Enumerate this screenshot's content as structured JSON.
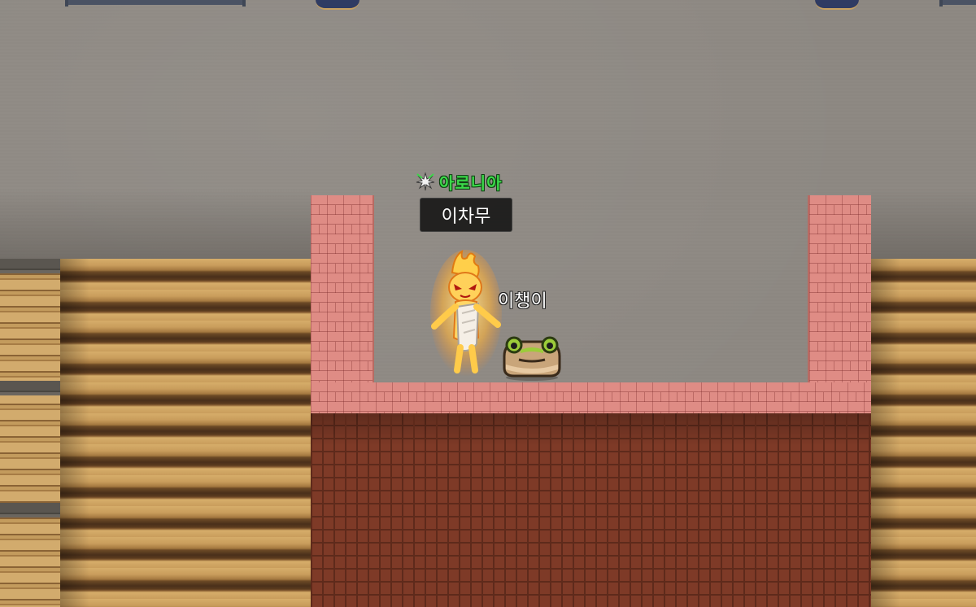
{
  "player": {
    "guild_name": "아로니아",
    "guild_icon": "leaf-emblem-icon",
    "name": "이차무"
  },
  "pet": {
    "name": "이챙이",
    "icon": "frog-pet-icon"
  },
  "colors": {
    "guild_text": "#3cd84a",
    "brick_top": "#df8c85",
    "brick_front": "#7e3a27",
    "floor": "#8e8983",
    "stairs": "#d6ad6a"
  }
}
